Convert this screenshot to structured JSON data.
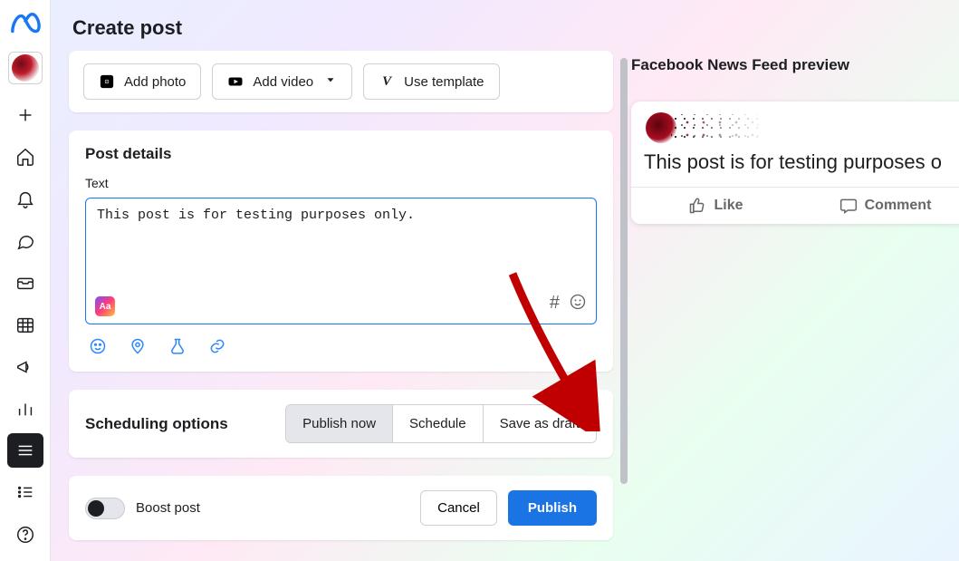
{
  "page_title": "Create post",
  "sidebar": {
    "icons": [
      "plus",
      "home",
      "bell",
      "chat",
      "inbox",
      "calendar",
      "megaphone",
      "bars",
      "menu",
      "list",
      "help"
    ]
  },
  "media_buttons": {
    "photo": "Add photo",
    "video": "Add video",
    "template": "Use template"
  },
  "post_details": {
    "heading": "Post details",
    "text_label": "Text",
    "text_value": "This post is for testing purposes only.",
    "bg_chip": "Aa",
    "hashtag_hint": "#"
  },
  "scheduling": {
    "heading": "Scheduling options",
    "options": [
      "Publish now",
      "Schedule",
      "Save as draft"
    ],
    "active_index": 0
  },
  "footer": {
    "boost_label": "Boost post",
    "cancel": "Cancel",
    "publish": "Publish"
  },
  "preview": {
    "heading": "Facebook News Feed preview",
    "post_text": "This post is for testing purposes o",
    "like": "Like",
    "comment": "Comment"
  }
}
